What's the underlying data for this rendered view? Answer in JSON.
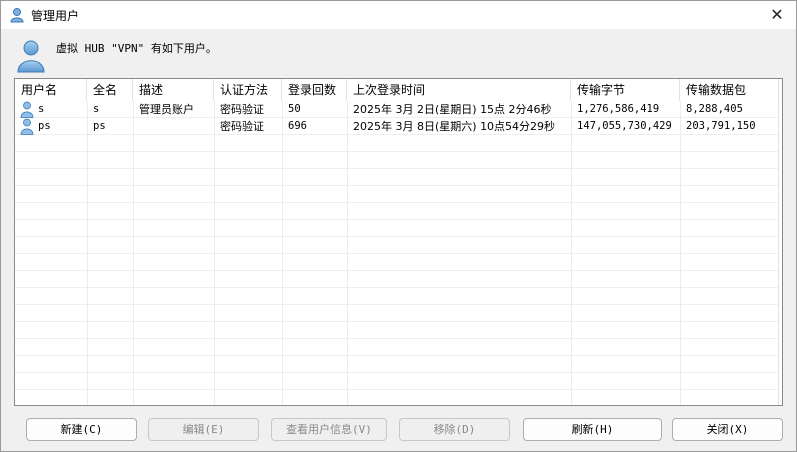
{
  "window": {
    "title": "管理用户"
  },
  "message": "虚拟 HUB \"VPN\" 有如下用户。",
  "columns": [
    "用户名",
    "全名",
    "描述",
    "认证方法",
    "登录回数",
    "上次登录时间",
    "传输字节",
    "传输数据包"
  ],
  "rows": [
    {
      "username": "s",
      "fullname": "s",
      "description": "管理员账户",
      "auth": "密码验证",
      "logins": "50",
      "last_login": "2025年 3月 2日(星期日) 15点 2分46秒",
      "bytes": "1,276,586,419",
      "packets": "8,288,405"
    },
    {
      "username": "ps",
      "fullname": "ps",
      "description": "",
      "auth": "密码验证",
      "logins": "696",
      "last_login": "2025年 3月 8日(星期六) 10点54分29秒",
      "bytes": "147,055,730,429",
      "packets": "203,791,150"
    }
  ],
  "buttons": {
    "new": "新建(C)",
    "edit": "编辑(E)",
    "view": "查看用户信息(V)",
    "remove": "移除(D)",
    "refresh": "刷新(H)",
    "close": "关闭(X)"
  },
  "icons": {
    "title": "user-icon",
    "close": "close-icon"
  }
}
